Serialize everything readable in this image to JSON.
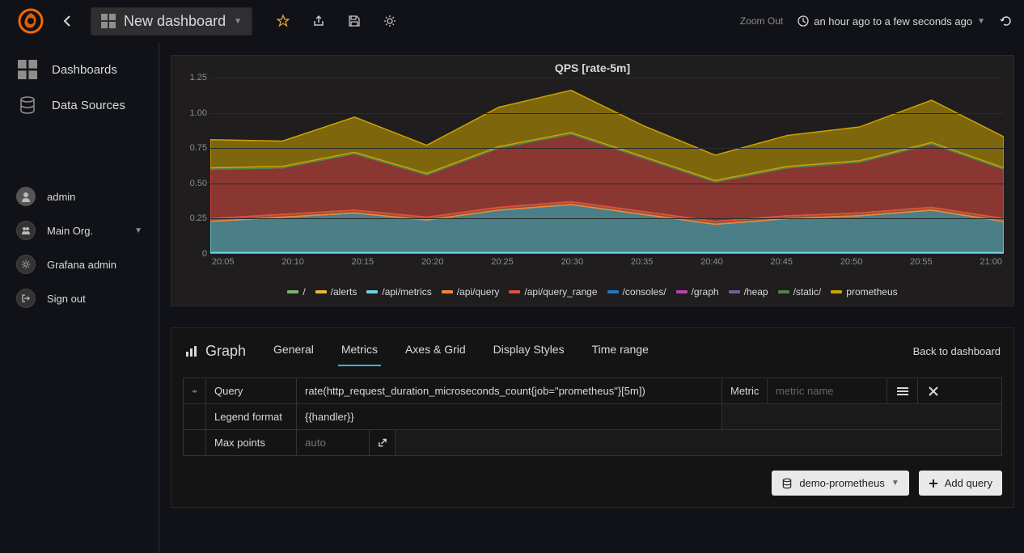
{
  "header": {
    "dashboard_name": "New dashboard",
    "zoom": "Zoom Out",
    "time_range": "an hour ago to a few seconds ago"
  },
  "sidebar": {
    "items": [
      {
        "label": "Dashboards"
      },
      {
        "label": "Data Sources"
      }
    ],
    "user": "admin",
    "org": "Main Org.",
    "admin": "Grafana admin",
    "signout": "Sign out"
  },
  "panel": {
    "title": "QPS [rate-5m]"
  },
  "chart_data": {
    "type": "area",
    "stacked": true,
    "title": "QPS [rate-5m]",
    "xlabel": "",
    "ylabel": "",
    "ylim": [
      0,
      1.25
    ],
    "yticks": [
      0,
      0.25,
      0.5,
      0.75,
      1.0,
      1.25
    ],
    "x": [
      "20:05",
      "20:10",
      "20:15",
      "20:20",
      "20:25",
      "20:30",
      "20:35",
      "20:40",
      "20:45",
      "20:50",
      "20:55",
      "21:00"
    ],
    "series": [
      {
        "name": "/",
        "color": "#7eb26d",
        "values": [
          0.01,
          0.01,
          0.01,
          0.01,
          0.01,
          0.01,
          0.01,
          0.01,
          0.01,
          0.01,
          0.01,
          0.01
        ]
      },
      {
        "name": "/alerts",
        "color": "#eab839",
        "values": [
          0.0,
          0.0,
          0.0,
          0.0,
          0.0,
          0.0,
          0.0,
          0.0,
          0.0,
          0.0,
          0.0,
          0.0
        ]
      },
      {
        "name": "/api/metrics",
        "color": "#6ed0e0",
        "values": [
          0.22,
          0.25,
          0.28,
          0.23,
          0.3,
          0.34,
          0.27,
          0.2,
          0.24,
          0.26,
          0.3,
          0.22
        ]
      },
      {
        "name": "/api/query",
        "color": "#ef843c",
        "values": [
          0.02,
          0.02,
          0.02,
          0.02,
          0.02,
          0.02,
          0.02,
          0.02,
          0.02,
          0.02,
          0.02,
          0.02
        ]
      },
      {
        "name": "/api/query_range",
        "color": "#e24d42",
        "values": [
          0.35,
          0.33,
          0.4,
          0.3,
          0.42,
          0.48,
          0.38,
          0.28,
          0.34,
          0.36,
          0.45,
          0.35
        ]
      },
      {
        "name": "/consoles/",
        "color": "#1f78c1",
        "values": [
          0.0,
          0.0,
          0.0,
          0.0,
          0.0,
          0.0,
          0.0,
          0.0,
          0.0,
          0.0,
          0.0,
          0.0
        ]
      },
      {
        "name": "/graph",
        "color": "#ba43a9",
        "values": [
          0.0,
          0.0,
          0.0,
          0.0,
          0.0,
          0.0,
          0.0,
          0.0,
          0.0,
          0.0,
          0.0,
          0.0
        ]
      },
      {
        "name": "/heap",
        "color": "#705da0",
        "values": [
          0.0,
          0.0,
          0.0,
          0.0,
          0.0,
          0.0,
          0.0,
          0.0,
          0.0,
          0.0,
          0.0,
          0.0
        ]
      },
      {
        "name": "/static/",
        "color": "#508642",
        "values": [
          0.01,
          0.01,
          0.01,
          0.01,
          0.01,
          0.01,
          0.01,
          0.01,
          0.01,
          0.01,
          0.01,
          0.01
        ]
      },
      {
        "name": "prometheus",
        "color": "#cca300",
        "values": [
          0.2,
          0.18,
          0.25,
          0.2,
          0.28,
          0.3,
          0.22,
          0.18,
          0.22,
          0.24,
          0.3,
          0.22
        ]
      }
    ]
  },
  "editor": {
    "title": "Graph",
    "tabs": [
      "General",
      "Metrics",
      "Axes & Grid",
      "Display Styles",
      "Time range"
    ],
    "active_tab": 1,
    "back": "Back to dashboard",
    "rows": {
      "query_label": "Query",
      "query_value": "rate(http_request_duration_microseconds_count{job=\"prometheus\"}[5m])",
      "metric_label": "Metric",
      "metric_placeholder": "metric name",
      "legend_label": "Legend format",
      "legend_value": "{{handler}}",
      "maxpoints_label": "Max points",
      "maxpoints_placeholder": "auto"
    },
    "datasource": "demo-prometheus",
    "add_query": "Add query"
  }
}
